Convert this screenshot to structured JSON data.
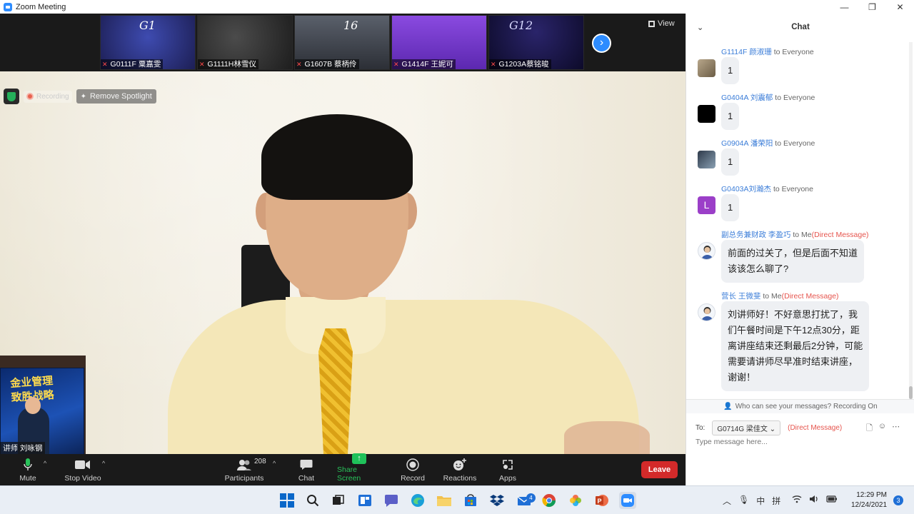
{
  "window": {
    "title": "Zoom Meeting",
    "controls": [
      "—",
      "❐",
      "✕"
    ]
  },
  "thumbnails": [
    {
      "tag": "G1",
      "name": "G0111F 粟嘉雯",
      "bg": "#2a2f6e"
    },
    {
      "tag": "",
      "name": "G1111H林雪仪",
      "bg": "#3a3a3a"
    },
    {
      "tag": "16",
      "name": "G1607B 蔡柄伶",
      "bg": "#4a4f5a"
    },
    {
      "tag": "",
      "name": "G1414F 王妮可",
      "bg": "#7b3fd4"
    },
    {
      "tag": "G12",
      "name": "G1203A蔡铭晙",
      "bg": "#15123f"
    }
  ],
  "view_label": "View",
  "badges": {
    "recording": "Recording",
    "remove_spotlight": "Remove Spotlight"
  },
  "speaker": {
    "name": "讲师 刘咏钢"
  },
  "video_book": {
    "title": "金业管理\n致胜战略"
  },
  "toolbar": {
    "mute": "Mute",
    "stop_video": "Stop Video",
    "participants": "Participants",
    "participant_count": "208",
    "chat": "Chat",
    "share_screen": "Share Screen",
    "record": "Record",
    "reactions": "Reactions",
    "apps": "Apps",
    "leave": "Leave"
  },
  "chat": {
    "title": "Chat",
    "messages": [
      {
        "from": "G1114F 颜淑珊",
        "to": "to Everyone",
        "dm": "",
        "text": "1"
      },
      {
        "from": "G0404A 刘震郁",
        "to": "to Everyone",
        "dm": "",
        "text": "1"
      },
      {
        "from": "G0904A 潘荣阳",
        "to": "to Everyone",
        "dm": "",
        "text": "1"
      },
      {
        "from": "G0403A刘瀚杰",
        "to": "to Everyone",
        "dm": "",
        "text": "1",
        "avatar_letter": "L"
      },
      {
        "from": "副总务兼财政 李盈巧",
        "to": "to Me",
        "dm": "(Direct Message)",
        "text": "前面的过关了，但是后面不知道\n该该怎么聊了?"
      },
      {
        "from": "营长 王微斐",
        "to": "to Me",
        "dm": "(Direct Message)",
        "text": "刘讲师好！不好意思打扰了，我\n们午餐时间是下午12点30分，距\n离讲座结束还剩最后2分钟，可能\n需要请讲师尽早准时结束讲座，\n谢谢！"
      }
    ],
    "who_can_see": "Who can see your messages? Recording On",
    "to_label": "To:",
    "recipient": "G0714G 梁佳文",
    "recipient_dm": "(Direct Message)",
    "input_placeholder": "Type message here..."
  },
  "taskbar": {
    "mail_badge": "4",
    "ime_1": "中",
    "ime_2": "拼",
    "time": "12:29 PM",
    "date": "12/24/2021",
    "notifications": "3"
  }
}
